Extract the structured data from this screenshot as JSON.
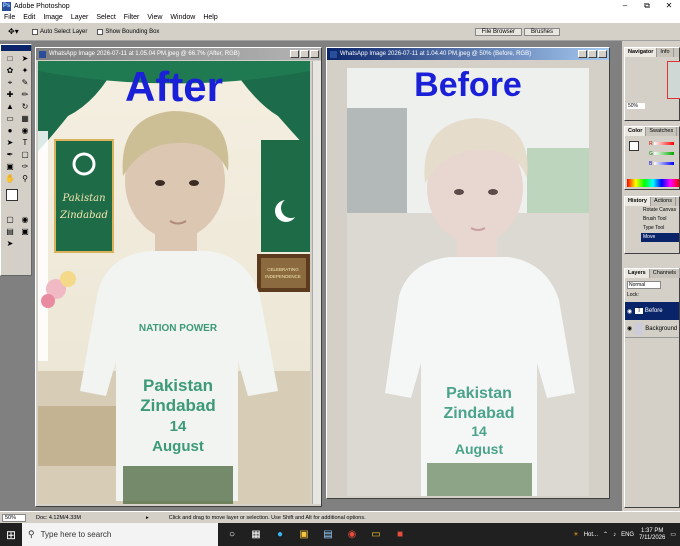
{
  "app": {
    "title": "Adobe Photoshop",
    "icon": "photoshop-icon"
  },
  "menu": [
    "File",
    "Edit",
    "Image",
    "Layer",
    "Select",
    "Filter",
    "View",
    "Window",
    "Help"
  ],
  "options": {
    "auto_select_layer": "Auto Select Layer",
    "show_bounding_box": "Show Bounding Box",
    "palette_tabs": [
      "File Browser",
      "Brushes"
    ]
  },
  "doc_after": {
    "title": "WhatsApp Image 2026-07-11 at 1.05.04 PM.jpeg @ 66.7% (After, RGB)",
    "overlay": "After",
    "sign_text": "Pakistan Zindabad",
    "board_text": "CELEBRATING INDEPENDENCE"
  },
  "doc_before": {
    "title": "WhatsApp Image 2026-07-11 at 1.04.40 PM.jpeg @ 50% (Before, RGB)",
    "overlay": "Before"
  },
  "shirt": {
    "line1": "NATION POWER",
    "line2": "Pakistan",
    "line3": "Zindabad",
    "line4": "14",
    "line5": "August"
  },
  "navigator": {
    "tabs": [
      "Navigator",
      "Info"
    ],
    "zoom": "50%"
  },
  "color": {
    "tabs": [
      "Color",
      "Swatches"
    ],
    "channels": [
      "R",
      "G",
      "B"
    ]
  },
  "history": {
    "tabs": [
      "History",
      "Actions"
    ],
    "items": [
      "Rotate Canvas",
      "Brush Tool",
      "Type Tool",
      "Move"
    ]
  },
  "layers": {
    "tabs": [
      "Layers",
      "Channels"
    ],
    "blend": "Normal",
    "lock_label": "Lock:",
    "rows": [
      "Before",
      "Background"
    ]
  },
  "status": {
    "zoom": "50%",
    "doc": "Doc: 4.12M/4.33M",
    "hint": "Click and drag to move layer or selection.  Use Shift and Alt for additional options."
  },
  "taskbar": {
    "search_placeholder": "Type here to search",
    "weather": "Hot...",
    "lang": "ENG",
    "time": "1:37 PM",
    "date": "7/11/2026"
  }
}
